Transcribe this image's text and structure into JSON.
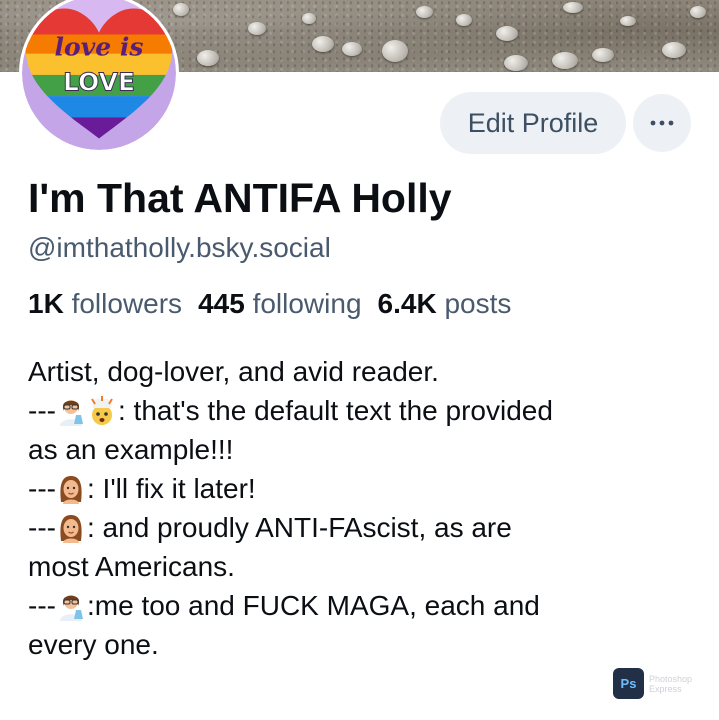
{
  "profile": {
    "avatar_text_line1": "love is",
    "avatar_text_line2": "LOVE",
    "display_name": "I'm That ANTIFA Holly",
    "handle": "@imthatholly.bsky.social"
  },
  "actions": {
    "edit_profile_label": "Edit Profile",
    "more_label": "···"
  },
  "stats": {
    "followers_count": "1K",
    "followers_label": "followers",
    "following_count": "445",
    "following_label": "following",
    "posts_count": "6.4K",
    "posts_label": "posts"
  },
  "bio": {
    "line1": "Artist, dog-lover, and avid reader.",
    "line2_prefix": "---",
    "line2_text": ": that's the default text the provided",
    "line3": "as an example!!!",
    "line4_prefix": "---",
    "line4_text": ": I'll fix it later!",
    "line5_prefix": "---",
    "line5_text": ": and proudly ANTI-FAscist, as are",
    "line6": "most Americans.",
    "line7_prefix": "---",
    "line7_text": ":me too and FUCK MAGA, each and",
    "line8": "every one."
  },
  "watermark": {
    "logo_text": "Ps",
    "line1": "Photoshop",
    "line2": "Express"
  },
  "icons": {
    "more": "ellipsis-icon",
    "emoji_scientist": "woman-scientist-emoji",
    "emoji_mind_blown": "exploding-head-emoji",
    "emoji_woman": "woman-emoji"
  },
  "colors": {
    "text_primary": "#0b0f14",
    "text_secondary": "#4a5a6e",
    "button_bg": "#edf1f5",
    "button_text": "#3d4f62"
  }
}
